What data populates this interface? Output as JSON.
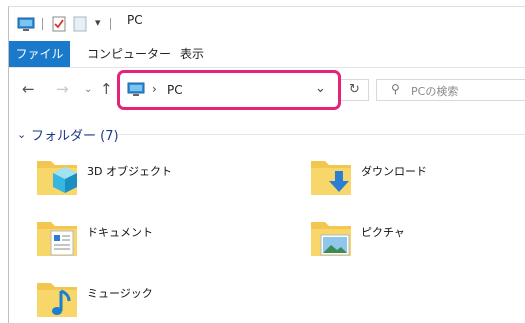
{
  "window": {
    "title": "PC"
  },
  "ribbon": {
    "tabs": [
      "ファイル",
      "コンピューター",
      "表示"
    ]
  },
  "address": {
    "location": "PC"
  },
  "search": {
    "placeholder": "PCの検索"
  },
  "content": {
    "group": {
      "title": "フォルダー (7)"
    },
    "folders": [
      {
        "label": "3D オブジェクト",
        "icon": "3d-objects-icon"
      },
      {
        "label": "ダウンロード",
        "icon": "download-folder-icon"
      },
      {
        "label": "ドキュメント",
        "icon": "documents-folder-icon"
      },
      {
        "label": "ピクチャ",
        "icon": "pictures-folder-icon"
      },
      {
        "label": "ミュージック",
        "icon": "music-folder-icon"
      }
    ]
  },
  "colors": {
    "accent": "#1979ca",
    "highlight": "#e5227c",
    "folder": "#f3c74f"
  }
}
